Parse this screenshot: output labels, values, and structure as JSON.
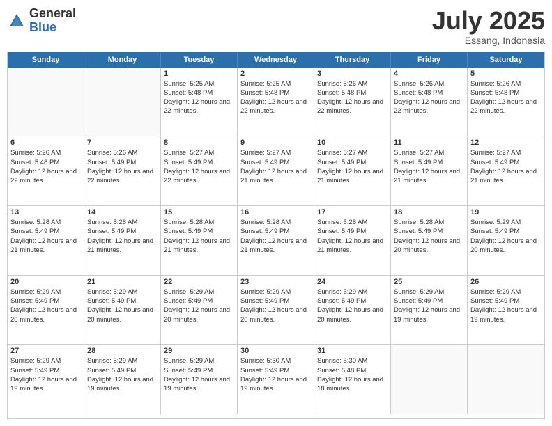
{
  "logo": {
    "general": "General",
    "blue": "Blue"
  },
  "header": {
    "month_year": "July 2025",
    "location": "Essang, Indonesia"
  },
  "weekdays": [
    "Sunday",
    "Monday",
    "Tuesday",
    "Wednesday",
    "Thursday",
    "Friday",
    "Saturday"
  ],
  "weeks": [
    [
      {
        "day": "",
        "sunrise": "",
        "sunset": "",
        "daylight": ""
      },
      {
        "day": "",
        "sunrise": "",
        "sunset": "",
        "daylight": ""
      },
      {
        "day": "1",
        "sunrise": "Sunrise: 5:25 AM",
        "sunset": "Sunset: 5:48 PM",
        "daylight": "Daylight: 12 hours and 22 minutes."
      },
      {
        "day": "2",
        "sunrise": "Sunrise: 5:25 AM",
        "sunset": "Sunset: 5:48 PM",
        "daylight": "Daylight: 12 hours and 22 minutes."
      },
      {
        "day": "3",
        "sunrise": "Sunrise: 5:26 AM",
        "sunset": "Sunset: 5:48 PM",
        "daylight": "Daylight: 12 hours and 22 minutes."
      },
      {
        "day": "4",
        "sunrise": "Sunrise: 5:26 AM",
        "sunset": "Sunset: 5:48 PM",
        "daylight": "Daylight: 12 hours and 22 minutes."
      },
      {
        "day": "5",
        "sunrise": "Sunrise: 5:26 AM",
        "sunset": "Sunset: 5:48 PM",
        "daylight": "Daylight: 12 hours and 22 minutes."
      }
    ],
    [
      {
        "day": "6",
        "sunrise": "Sunrise: 5:26 AM",
        "sunset": "Sunset: 5:48 PM",
        "daylight": "Daylight: 12 hours and 22 minutes."
      },
      {
        "day": "7",
        "sunrise": "Sunrise: 5:26 AM",
        "sunset": "Sunset: 5:49 PM",
        "daylight": "Daylight: 12 hours and 22 minutes."
      },
      {
        "day": "8",
        "sunrise": "Sunrise: 5:27 AM",
        "sunset": "Sunset: 5:49 PM",
        "daylight": "Daylight: 12 hours and 22 minutes."
      },
      {
        "day": "9",
        "sunrise": "Sunrise: 5:27 AM",
        "sunset": "Sunset: 5:49 PM",
        "daylight": "Daylight: 12 hours and 21 minutes."
      },
      {
        "day": "10",
        "sunrise": "Sunrise: 5:27 AM",
        "sunset": "Sunset: 5:49 PM",
        "daylight": "Daylight: 12 hours and 21 minutes."
      },
      {
        "day": "11",
        "sunrise": "Sunrise: 5:27 AM",
        "sunset": "Sunset: 5:49 PM",
        "daylight": "Daylight: 12 hours and 21 minutes."
      },
      {
        "day": "12",
        "sunrise": "Sunrise: 5:27 AM",
        "sunset": "Sunset: 5:49 PM",
        "daylight": "Daylight: 12 hours and 21 minutes."
      }
    ],
    [
      {
        "day": "13",
        "sunrise": "Sunrise: 5:28 AM",
        "sunset": "Sunset: 5:49 PM",
        "daylight": "Daylight: 12 hours and 21 minutes."
      },
      {
        "day": "14",
        "sunrise": "Sunrise: 5:28 AM",
        "sunset": "Sunset: 5:49 PM",
        "daylight": "Daylight: 12 hours and 21 minutes."
      },
      {
        "day": "15",
        "sunrise": "Sunrise: 5:28 AM",
        "sunset": "Sunset: 5:49 PM",
        "daylight": "Daylight: 12 hours and 21 minutes."
      },
      {
        "day": "16",
        "sunrise": "Sunrise: 5:28 AM",
        "sunset": "Sunset: 5:49 PM",
        "daylight": "Daylight: 12 hours and 21 minutes."
      },
      {
        "day": "17",
        "sunrise": "Sunrise: 5:28 AM",
        "sunset": "Sunset: 5:49 PM",
        "daylight": "Daylight: 12 hours and 21 minutes."
      },
      {
        "day": "18",
        "sunrise": "Sunrise: 5:28 AM",
        "sunset": "Sunset: 5:49 PM",
        "daylight": "Daylight: 12 hours and 20 minutes."
      },
      {
        "day": "19",
        "sunrise": "Sunrise: 5:29 AM",
        "sunset": "Sunset: 5:49 PM",
        "daylight": "Daylight: 12 hours and 20 minutes."
      }
    ],
    [
      {
        "day": "20",
        "sunrise": "Sunrise: 5:29 AM",
        "sunset": "Sunset: 5:49 PM",
        "daylight": "Daylight: 12 hours and 20 minutes."
      },
      {
        "day": "21",
        "sunrise": "Sunrise: 5:29 AM",
        "sunset": "Sunset: 5:49 PM",
        "daylight": "Daylight: 12 hours and 20 minutes."
      },
      {
        "day": "22",
        "sunrise": "Sunrise: 5:29 AM",
        "sunset": "Sunset: 5:49 PM",
        "daylight": "Daylight: 12 hours and 20 minutes."
      },
      {
        "day": "23",
        "sunrise": "Sunrise: 5:29 AM",
        "sunset": "Sunset: 5:49 PM",
        "daylight": "Daylight: 12 hours and 20 minutes."
      },
      {
        "day": "24",
        "sunrise": "Sunrise: 5:29 AM",
        "sunset": "Sunset: 5:49 PM",
        "daylight": "Daylight: 12 hours and 20 minutes."
      },
      {
        "day": "25",
        "sunrise": "Sunrise: 5:29 AM",
        "sunset": "Sunset: 5:49 PM",
        "daylight": "Daylight: 12 hours and 19 minutes."
      },
      {
        "day": "26",
        "sunrise": "Sunrise: 5:29 AM",
        "sunset": "Sunset: 5:49 PM",
        "daylight": "Daylight: 12 hours and 19 minutes."
      }
    ],
    [
      {
        "day": "27",
        "sunrise": "Sunrise: 5:29 AM",
        "sunset": "Sunset: 5:49 PM",
        "daylight": "Daylight: 12 hours and 19 minutes."
      },
      {
        "day": "28",
        "sunrise": "Sunrise: 5:29 AM",
        "sunset": "Sunset: 5:49 PM",
        "daylight": "Daylight: 12 hours and 19 minutes."
      },
      {
        "day": "29",
        "sunrise": "Sunrise: 5:29 AM",
        "sunset": "Sunset: 5:49 PM",
        "daylight": "Daylight: 12 hours and 19 minutes."
      },
      {
        "day": "30",
        "sunrise": "Sunrise: 5:30 AM",
        "sunset": "Sunset: 5:49 PM",
        "daylight": "Daylight: 12 hours and 19 minutes."
      },
      {
        "day": "31",
        "sunrise": "Sunrise: 5:30 AM",
        "sunset": "Sunset: 5:48 PM",
        "daylight": "Daylight: 12 hours and 18 minutes."
      },
      {
        "day": "",
        "sunrise": "",
        "sunset": "",
        "daylight": ""
      },
      {
        "day": "",
        "sunrise": "",
        "sunset": "",
        "daylight": ""
      }
    ]
  ]
}
